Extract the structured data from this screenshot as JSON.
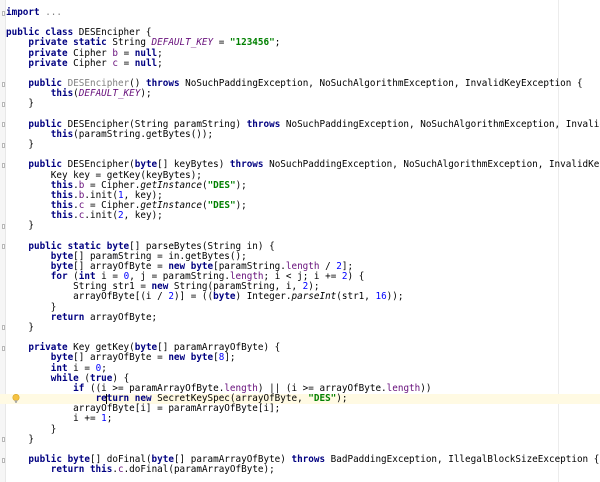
{
  "editor": {
    "lines": [
      [
        [
          "kw",
          "import"
        ],
        [
          "p",
          " "
        ],
        [
          "unused",
          "..."
        ]
      ],
      [],
      [
        [
          "kw",
          "public class"
        ],
        [
          "p",
          " DESEncipher {"
        ]
      ],
      [
        [
          "p",
          "    "
        ],
        [
          "kw",
          "private static"
        ],
        [
          "p",
          " String "
        ],
        [
          "sf",
          "DEFAULT_KEY"
        ],
        [
          "p",
          " = "
        ],
        [
          "str",
          "\"123456\""
        ],
        [
          "p",
          ";"
        ]
      ],
      [
        [
          "p",
          "    "
        ],
        [
          "kw",
          "private"
        ],
        [
          "p",
          " Cipher "
        ],
        [
          "fl",
          "b"
        ],
        [
          "p",
          " = "
        ],
        [
          "kw",
          "null"
        ],
        [
          "p",
          ";"
        ]
      ],
      [
        [
          "p",
          "    "
        ],
        [
          "kw",
          "private"
        ],
        [
          "p",
          " Cipher "
        ],
        [
          "fl",
          "c"
        ],
        [
          "p",
          " = "
        ],
        [
          "kw",
          "null"
        ],
        [
          "p",
          ";"
        ]
      ],
      [],
      [
        [
          "p",
          "    "
        ],
        [
          "kw",
          "public"
        ],
        [
          "p",
          " "
        ],
        [
          "unused",
          "DESEncipher"
        ],
        [
          "p",
          "() "
        ],
        [
          "kw",
          "throws"
        ],
        [
          "p",
          " NoSuchPaddingException, NoSuchAlgorithmException, InvalidKeyException {"
        ]
      ],
      [
        [
          "p",
          "        "
        ],
        [
          "kw",
          "this"
        ],
        [
          "p",
          "("
        ],
        [
          "sf",
          "DEFAULT_KEY"
        ],
        [
          "p",
          ");"
        ]
      ],
      [
        [
          "p",
          "    }"
        ]
      ],
      [],
      [
        [
          "p",
          "    "
        ],
        [
          "kw",
          "public"
        ],
        [
          "p",
          " DESEncipher(String paramString) "
        ],
        [
          "kw",
          "throws"
        ],
        [
          "p",
          " NoSuchPaddingException, NoSuchAlgorithmException, InvalidKeyException {"
        ]
      ],
      [
        [
          "p",
          "        "
        ],
        [
          "kw",
          "this"
        ],
        [
          "p",
          "(paramString.getBytes());"
        ]
      ],
      [
        [
          "p",
          "    }"
        ]
      ],
      [],
      [
        [
          "p",
          "    "
        ],
        [
          "kw",
          "public"
        ],
        [
          "p",
          " DESEncipher("
        ],
        [
          "kw",
          "byte"
        ],
        [
          "p",
          "[] keyBytes) "
        ],
        [
          "kw",
          "throws"
        ],
        [
          "p",
          " NoSuchPaddingException, NoSuchAlgorithmException, InvalidKeyException {"
        ]
      ],
      [
        [
          "p",
          "        Key key = getKey(keyBytes);"
        ]
      ],
      [
        [
          "p",
          "        "
        ],
        [
          "kw",
          "this"
        ],
        [
          "p",
          "."
        ],
        [
          "fl",
          "b"
        ],
        [
          "p",
          " = Cipher."
        ],
        [
          "it",
          "getInstance"
        ],
        [
          "p",
          "("
        ],
        [
          "str",
          "\"DES\""
        ],
        [
          "p",
          ");"
        ]
      ],
      [
        [
          "p",
          "        "
        ],
        [
          "kw",
          "this"
        ],
        [
          "p",
          "."
        ],
        [
          "fl",
          "b"
        ],
        [
          "p",
          ".init("
        ],
        [
          "num",
          "1"
        ],
        [
          "p",
          ", key);"
        ]
      ],
      [
        [
          "p",
          "        "
        ],
        [
          "kw",
          "this"
        ],
        [
          "p",
          "."
        ],
        [
          "fl",
          "c"
        ],
        [
          "p",
          " = Cipher."
        ],
        [
          "it",
          "getInstance"
        ],
        [
          "p",
          "("
        ],
        [
          "str",
          "\"DES\""
        ],
        [
          "p",
          ");"
        ]
      ],
      [
        [
          "p",
          "        "
        ],
        [
          "kw",
          "this"
        ],
        [
          "p",
          "."
        ],
        [
          "fl",
          "c"
        ],
        [
          "p",
          ".init("
        ],
        [
          "num",
          "2"
        ],
        [
          "p",
          ", key);"
        ]
      ],
      [
        [
          "p",
          "    }"
        ]
      ],
      [],
      [
        [
          "p",
          "    "
        ],
        [
          "kw",
          "public static byte"
        ],
        [
          "p",
          "[] parseBytes(String in) {"
        ]
      ],
      [
        [
          "p",
          "        "
        ],
        [
          "kw",
          "byte"
        ],
        [
          "p",
          "[] paramString = in.getBytes();"
        ]
      ],
      [
        [
          "p",
          "        "
        ],
        [
          "kw",
          "byte"
        ],
        [
          "p",
          "[] arrayOfByte = "
        ],
        [
          "kw",
          "new byte"
        ],
        [
          "p",
          "[paramString."
        ],
        [
          "fl",
          "length"
        ],
        [
          "p",
          " / "
        ],
        [
          "num",
          "2"
        ],
        [
          "p",
          "];"
        ]
      ],
      [
        [
          "p",
          "        "
        ],
        [
          "kw",
          "for"
        ],
        [
          "p",
          " ("
        ],
        [
          "kw",
          "int"
        ],
        [
          "p",
          " i = "
        ],
        [
          "num",
          "0"
        ],
        [
          "p",
          ", j = paramString."
        ],
        [
          "fl",
          "length"
        ],
        [
          "p",
          "; i < j; i += "
        ],
        [
          "num",
          "2"
        ],
        [
          "p",
          ") {"
        ]
      ],
      [
        [
          "p",
          "            String str1 = "
        ],
        [
          "kw",
          "new"
        ],
        [
          "p",
          " String(paramString, i, "
        ],
        [
          "num",
          "2"
        ],
        [
          "p",
          ");"
        ]
      ],
      [
        [
          "p",
          "            arrayOfByte[(i / "
        ],
        [
          "num",
          "2"
        ],
        [
          "p",
          ")] = (("
        ],
        [
          "kw",
          "byte"
        ],
        [
          "p",
          ") Integer."
        ],
        [
          "it",
          "parseInt"
        ],
        [
          "p",
          "(str1, "
        ],
        [
          "num",
          "16"
        ],
        [
          "p",
          "));"
        ]
      ],
      [
        [
          "p",
          "        }"
        ]
      ],
      [
        [
          "p",
          "        "
        ],
        [
          "kw",
          "return"
        ],
        [
          "p",
          " arrayOfByte;"
        ]
      ],
      [
        [
          "p",
          "    }"
        ]
      ],
      [],
      [
        [
          "p",
          "    "
        ],
        [
          "kw",
          "private"
        ],
        [
          "p",
          " Key getKey("
        ],
        [
          "kw",
          "byte"
        ],
        [
          "p",
          "[] paramArrayOfByte) {"
        ]
      ],
      [
        [
          "p",
          "        "
        ],
        [
          "kw",
          "byte"
        ],
        [
          "p",
          "[] arrayOfByte = "
        ],
        [
          "kw",
          "new byte"
        ],
        [
          "p",
          "["
        ],
        [
          "num",
          "8"
        ],
        [
          "p",
          "];"
        ]
      ],
      [
        [
          "p",
          "        "
        ],
        [
          "kw",
          "int"
        ],
        [
          "p",
          " i = "
        ],
        [
          "num",
          "0"
        ],
        [
          "p",
          ";"
        ]
      ],
      [
        [
          "p",
          "        "
        ],
        [
          "kw",
          "while"
        ],
        [
          "p",
          " ("
        ],
        [
          "kw",
          "true"
        ],
        [
          "p",
          ") {"
        ]
      ],
      [
        [
          "p",
          "            "
        ],
        [
          "kw",
          "if"
        ],
        [
          "p",
          " ((i >= paramArrayOfByte."
        ],
        [
          "fl",
          "length"
        ],
        [
          "p",
          ") || (i >= arrayOfByte."
        ],
        [
          "fl",
          "length"
        ],
        [
          "p",
          "))"
        ]
      ],
      [
        [
          "p",
          "                "
        ],
        [
          "kw",
          "re"
        ],
        [
          "caret",
          ""
        ],
        [
          "kw",
          "turn new"
        ],
        [
          "p",
          " SecretKeySpec(arrayOfByte, "
        ],
        [
          "str",
          "\"DES\""
        ],
        [
          "p",
          ");"
        ]
      ],
      [
        [
          "p",
          "            arrayOfByte[i] = paramArrayOfByte[i];"
        ]
      ],
      [
        [
          "p",
          "            i += "
        ],
        [
          "num",
          "1"
        ],
        [
          "p",
          ";"
        ]
      ],
      [
        [
          "p",
          "        }"
        ]
      ],
      [
        [
          "p",
          "    }"
        ]
      ],
      [],
      [
        [
          "p",
          "    "
        ],
        [
          "kw",
          "public byte"
        ],
        [
          "p",
          "[] doFinal("
        ],
        [
          "kw",
          "byte"
        ],
        [
          "p",
          "[] paramArrayOfByte) "
        ],
        [
          "kw",
          "throws"
        ],
        [
          "p",
          " BadPaddingException, IllegalBlockSizeException {"
        ]
      ],
      [
        [
          "p",
          "        "
        ],
        [
          "kw",
          "return this"
        ],
        [
          "p",
          "."
        ],
        [
          "fl",
          "c"
        ],
        [
          "p",
          ".doFinal(paramArrayOfByte);"
        ]
      ]
    ],
    "current_line": 38,
    "fold_lines": [
      0,
      7,
      9,
      11,
      13,
      15,
      21,
      23,
      31,
      33,
      42,
      44
    ],
    "bulb_icon": "lightbulb-icon",
    "bulb_color": "#f5c242"
  }
}
